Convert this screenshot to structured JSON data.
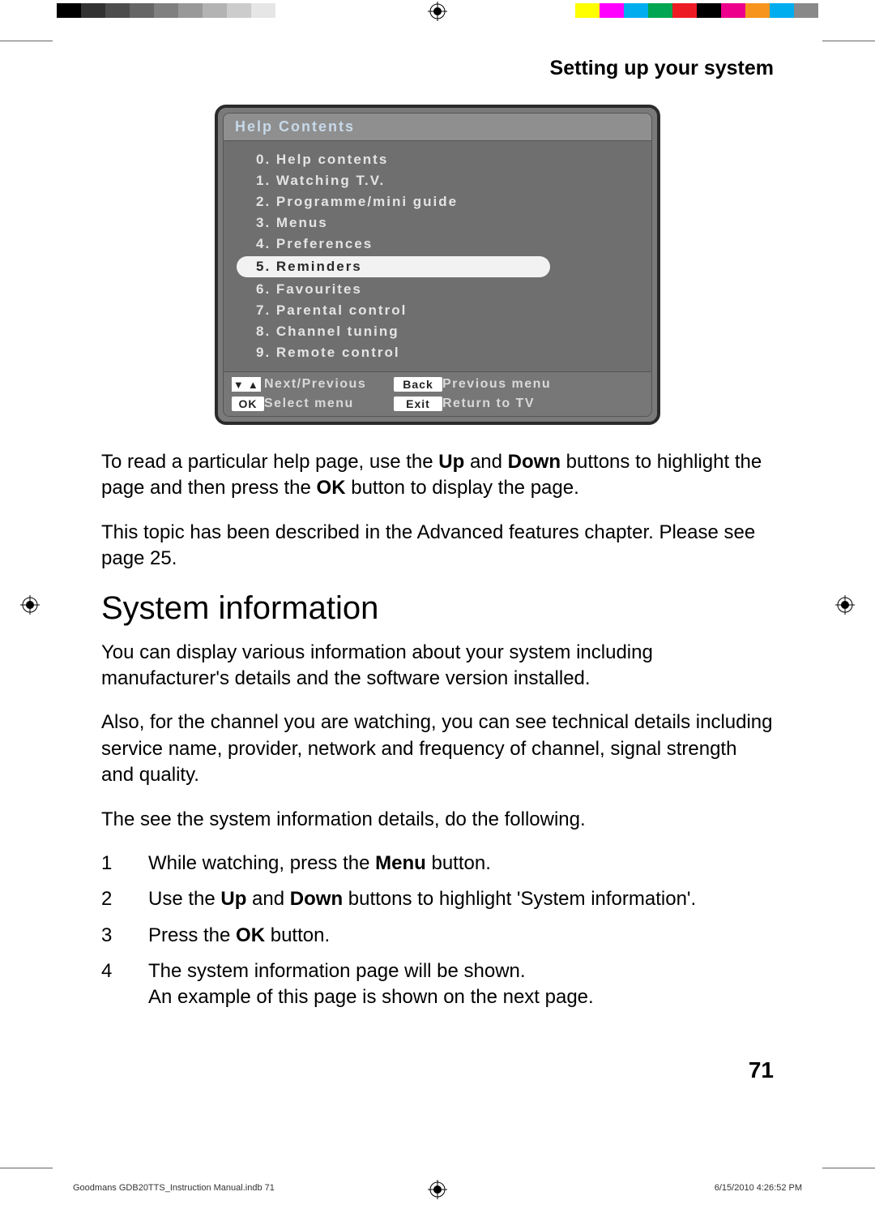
{
  "chapter_title": "Setting up your system",
  "tv_menu": {
    "title": "Help Contents",
    "items": [
      {
        "label": "0. Help contents",
        "selected": false
      },
      {
        "label": "1. Watching T.V.",
        "selected": false
      },
      {
        "label": "2. Programme/mini guide",
        "selected": false
      },
      {
        "label": "3. Menus",
        "selected": false
      },
      {
        "label": "4. Preferences",
        "selected": false
      },
      {
        "label": "5. Reminders",
        "selected": true
      },
      {
        "label": "6. Favourites",
        "selected": false
      },
      {
        "label": "7. Parental control",
        "selected": false
      },
      {
        "label": "8. Channel tuning",
        "selected": false
      },
      {
        "label": "9. Remote control",
        "selected": false
      }
    ],
    "footer": {
      "arrows_label": "Next/Previous",
      "back_key": "Back",
      "back_label": "Previous menu",
      "ok_key": "OK",
      "ok_label": "Select menu",
      "exit_key": "Exit",
      "exit_label": "Return to TV"
    }
  },
  "para1_a": "To read a particular help page, use the ",
  "para1_up": "Up",
  "para1_b": " and ",
  "para1_down": "Down",
  "para1_c": " buttons to highlight the page and then press the ",
  "para1_ok": "OK",
  "para1_d": " button to display the page.",
  "para2": "This topic has been described in the Advanced features chapter. Please see page 25.",
  "section_heading": "System information",
  "para3": "You can display various information about your system including manufacturer's details and the software version installed.",
  "para4": "Also, for the channel you are watching, you can see technical details including service name, provider, network and frequency of channel, signal strength and quality.",
  "para5": "The see the system information details, do the following.",
  "steps": [
    {
      "num": "1",
      "pre": "While watching, press the ",
      "bold": "Menu",
      "post": " button."
    },
    {
      "num": "2",
      "pre": "Use the ",
      "bold": "Up",
      "mid": " and ",
      "bold2": "Down",
      "post": " buttons to highlight  'System information'."
    },
    {
      "num": "3",
      "pre": "Press the ",
      "bold": "OK",
      "post": " button."
    },
    {
      "num": "4",
      "pre": "The system information page will be shown.\nAn example of this page is shown on the next page.",
      "bold": "",
      "post": ""
    }
  ],
  "page_number": "71",
  "footer_left": "Goodmans GDB20TTS_Instruction Manual.indb   71",
  "footer_right": "6/15/2010   4:26:52 PM",
  "color_bars_left": [
    "#000000",
    "#323232",
    "#4d4d4d",
    "#666666",
    "#808080",
    "#999999",
    "#b3b3b3",
    "#cccccc",
    "#e6e6e6",
    "#ffffff"
  ],
  "color_bars_right": [
    "#ffff00",
    "#ff00ff",
    "#00aeef",
    "#00a651",
    "#ed1c24",
    "#000000",
    "#ec008c",
    "#f7941d",
    "#00adef",
    "#898989"
  ]
}
